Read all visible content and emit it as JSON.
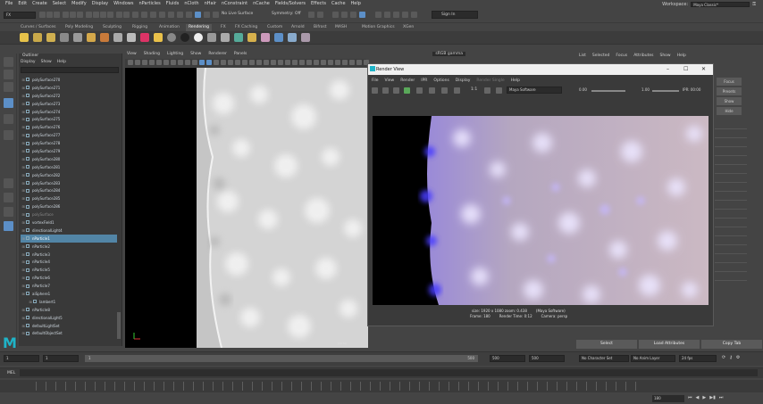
{
  "menubar": {
    "items": [
      "File",
      "Edit",
      "Create",
      "Select",
      "Modify",
      "Display",
      "Windows",
      "nParticles",
      "Fluids",
      "nCloth",
      "nHair",
      "nConstraint",
      "nCache",
      "Fields/Solvers",
      "Effects",
      "Cache",
      "Help"
    ],
    "workspace_label": "Workspace:",
    "workspace_value": "Maya Classic*"
  },
  "statusline": {
    "menuset": "FX",
    "live_surface": "No Live Surface",
    "symmetry": "Symmetry: Off",
    "signin": "Sign In"
  },
  "shelf": {
    "tabs": [
      "Curves / Surfaces",
      "Poly Modeling",
      "Sculpting",
      "Rigging",
      "Animation",
      "Rendering",
      "FX",
      "FX Caching",
      "Custom",
      "Arnold",
      "Bifrost",
      "MASH",
      "Motion Graphics",
      "XGen"
    ],
    "active_tab": "Rendering"
  },
  "outliner": {
    "title": "Outliner",
    "menu": [
      "Display",
      "Show",
      "Help"
    ],
    "items": [
      {
        "label": "polySurface270",
        "state": "normal"
      },
      {
        "label": "polySurface271",
        "state": "normal"
      },
      {
        "label": "polySurface272",
        "state": "normal"
      },
      {
        "label": "polySurface273",
        "state": "normal"
      },
      {
        "label": "polySurface274",
        "state": "normal"
      },
      {
        "label": "polySurface275",
        "state": "normal"
      },
      {
        "label": "polySurface276",
        "state": "normal"
      },
      {
        "label": "polySurface277",
        "state": "normal"
      },
      {
        "label": "polySurface278",
        "state": "normal"
      },
      {
        "label": "polySurface279",
        "state": "normal"
      },
      {
        "label": "polySurface280",
        "state": "normal"
      },
      {
        "label": "polySurface281",
        "state": "normal"
      },
      {
        "label": "polySurface282",
        "state": "normal"
      },
      {
        "label": "polySurface283",
        "state": "normal"
      },
      {
        "label": "polySurface284",
        "state": "normal"
      },
      {
        "label": "polySurface285",
        "state": "normal"
      },
      {
        "label": "polySurface286",
        "state": "normal"
      },
      {
        "label": "polySurface",
        "state": "dim"
      },
      {
        "label": "vortexField1",
        "state": "normal"
      },
      {
        "label": "directionalLight4",
        "state": "normal"
      },
      {
        "label": "nParticle1",
        "state": "selected"
      },
      {
        "label": "nParticle2",
        "state": "normal"
      },
      {
        "label": "nParticle3",
        "state": "normal"
      },
      {
        "label": "nParticle4",
        "state": "normal"
      },
      {
        "label": "nParticle5",
        "state": "normal"
      },
      {
        "label": "nParticle6",
        "state": "normal"
      },
      {
        "label": "nParticle7",
        "state": "normal"
      },
      {
        "label": "aiSphere1",
        "state": "normal"
      },
      {
        "label": "lambert1",
        "state": "normal"
      },
      {
        "label": "nParticle8",
        "state": "normal"
      },
      {
        "label": "directionalLight5",
        "state": "normal"
      },
      {
        "label": "defaultLightSet",
        "state": "normal"
      },
      {
        "label": "defaultObjectSet",
        "state": "normal"
      }
    ]
  },
  "viewport": {
    "menu": [
      "View",
      "Shading",
      "Lighting",
      "Show",
      "Renderer",
      "Panels"
    ],
    "camera_label": "persp",
    "colorspace": "sRGB gamma"
  },
  "render_view": {
    "title": "Render View",
    "menu": [
      "File",
      "View",
      "Render",
      "IPR",
      "Options",
      "Display",
      "Render Single",
      "Help"
    ],
    "zoom": "1:1",
    "renderer": "Maya Software",
    "exposure": "0.00",
    "gamma": "1.00",
    "ipr_label": "IPR: 00:00",
    "info_line1": [
      "size: 1920 x 1080  zoom: 0.438",
      "(Maya Software)"
    ],
    "info_line2": [
      "Frame: 180",
      "Render Time: 0:12",
      "Camera: persp"
    ]
  },
  "attribute_editor": {
    "tabs": [
      "List",
      "Selected",
      "Focus",
      "Attributes",
      "Show",
      "Help"
    ],
    "buttons": [
      "Focus",
      "Presets",
      "Show",
      "Hide"
    ],
    "bottom_buttons": [
      "Select",
      "Load Attributes",
      "Copy Tab"
    ]
  },
  "timeline": {
    "start": "1",
    "current": "1",
    "slider_frame": "1",
    "end_mark": "500",
    "range_end1": "500",
    "range_end2": "500",
    "character_set": "No Character Set",
    "anim_layer": "No Anim Layer",
    "fps": "24 fps",
    "current_frame": "180"
  },
  "command_line": {
    "language": "MEL"
  },
  "colors": {
    "accent": "#5285a6",
    "maya_logo": "#1fb4c8"
  }
}
